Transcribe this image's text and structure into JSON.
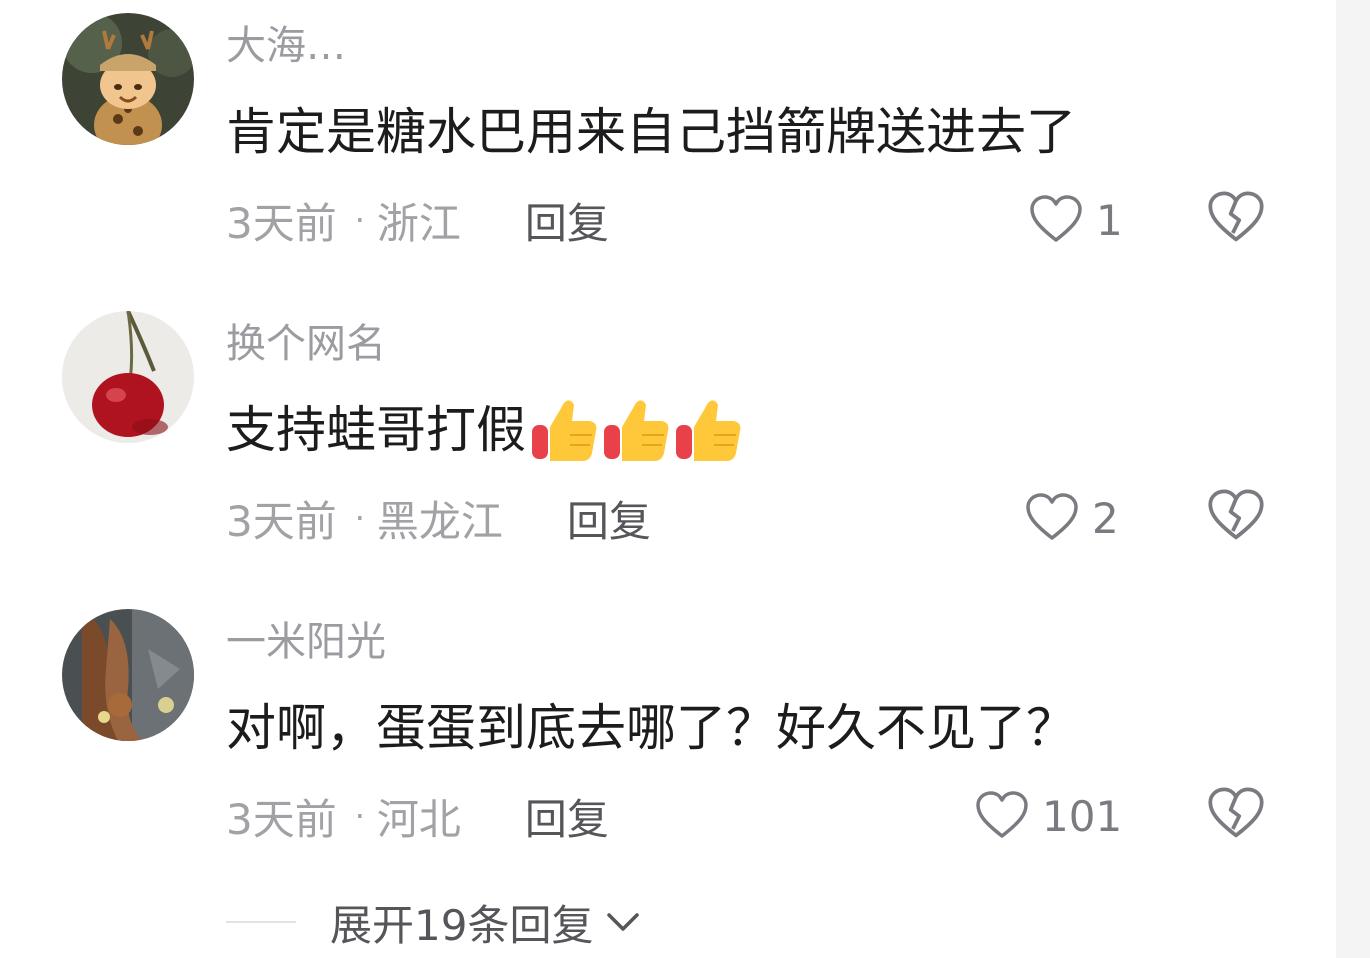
{
  "comments": [
    {
      "username": "大海…",
      "content": "肯定是糖水巴用来自己挡箭牌送进去了",
      "time": "3天前",
      "separator": "·",
      "location": "浙江",
      "reply_label": "回复",
      "likes": "1",
      "avatar_icon": "cat-in-deer-hat-avatar",
      "emoji_count": 0
    },
    {
      "username": "换个网名",
      "content": "支持蛙哥打假",
      "time": "3天前",
      "separator": "·",
      "location": "黑龙江",
      "reply_label": "回复",
      "likes": "2",
      "avatar_icon": "cherry-avatar",
      "emoji_count": 3,
      "emoji_icon": "thumbs-up-emoji"
    },
    {
      "username": "一米阳光",
      "content": "对啊，蛋蛋到底去哪了？好久不见了？",
      "time": "3天前",
      "separator": "·",
      "location": "河北",
      "reply_label": "回复",
      "likes": "101",
      "avatar_icon": "brown-hair-avatar",
      "emoji_count": 0
    }
  ],
  "expand": {
    "label": "展开19条回复",
    "icon": "chevron-down-icon"
  },
  "icons": {
    "like": "heart-outline-icon",
    "dislike": "broken-heart-icon"
  },
  "colors": {
    "username": "#9b9ba1",
    "content": "#1c1c1e",
    "meta": "#a1a1a6",
    "reply": "#55555a",
    "icon": "#7a7a80"
  }
}
